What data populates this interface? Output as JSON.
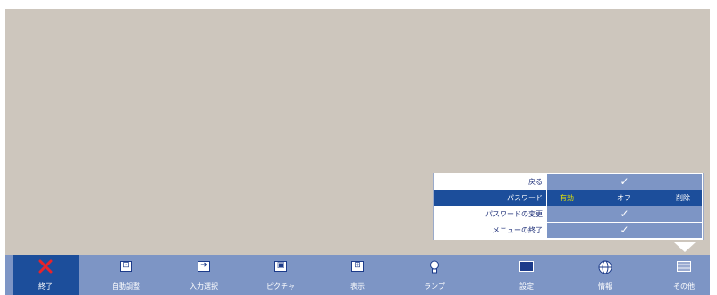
{
  "submenu": {
    "rows": [
      {
        "label": "戻る",
        "value": "✓"
      },
      {
        "label": "パスワード",
        "options": [
          "有効",
          "オフ",
          "削除"
        ]
      },
      {
        "label": "パスワードの変更",
        "value": "✓"
      },
      {
        "label": "メニューの終了",
        "value": "✓"
      }
    ]
  },
  "menubar": {
    "items": [
      {
        "label": "終了",
        "icon": "close-icon"
      },
      {
        "label": "自動調整",
        "icon": "auto-adjust-icon"
      },
      {
        "label": "入力選択",
        "icon": "input-select-icon"
      },
      {
        "label": "ピクチャ",
        "icon": "picture-icon"
      },
      {
        "label": "表示",
        "icon": "display-icon"
      },
      {
        "label": "ランプ",
        "icon": "lamp-icon"
      },
      {
        "label": "設定",
        "icon": "settings-icon"
      },
      {
        "label": "情報",
        "icon": "info-icon"
      },
      {
        "label": "その他",
        "icon": "other-icon"
      }
    ]
  },
  "colors": {
    "background": "#cdc6bd",
    "menubar": "#7d95c5",
    "selected": "#1c4e9b",
    "enabled_option": "#e8e800",
    "close_red": "#e8232a"
  }
}
